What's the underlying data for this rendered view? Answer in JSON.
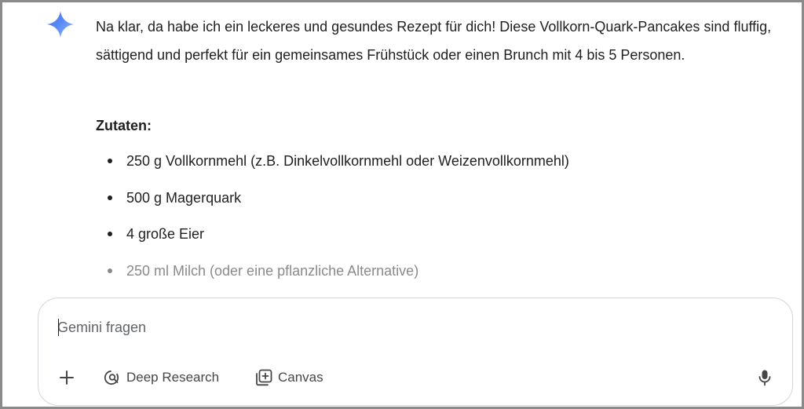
{
  "response": {
    "intro": "Na klar, da habe ich ein leckeres und gesundes Rezept für dich! Diese Vollkorn-Quark-Pancakes sind fluffig, sättigend und perfekt für ein gemeinsames Frühstück oder einen Brunch mit 4 bis 5 Personen.",
    "ingredients_heading": "Zutaten:",
    "ingredients": [
      "250 g Vollkornmehl (z.B. Dinkelvollkornmehl oder Weizenvollkornmehl)",
      "500 g Magerquark",
      "4 große Eier",
      "250 ml Milch (oder eine pflanzliche Alternative)"
    ]
  },
  "composer": {
    "placeholder": "Gemini fragen",
    "value": "",
    "tools": {
      "deep_research_label": "Deep Research",
      "canvas_label": "Canvas"
    }
  },
  "icons": {
    "logo": "gemini-spark-icon",
    "add": "plus-icon",
    "deep_research": "deep-research-icon",
    "canvas": "canvas-icon",
    "mic": "microphone-icon"
  },
  "colors": {
    "text": "#1f1f1f",
    "muted_text": "#8a8a8a",
    "tool_text": "#444746",
    "composer_border": "#d3d6da",
    "spark_gradient_start": "#4f7df3",
    "spark_gradient_end": "#8fb7ff"
  }
}
